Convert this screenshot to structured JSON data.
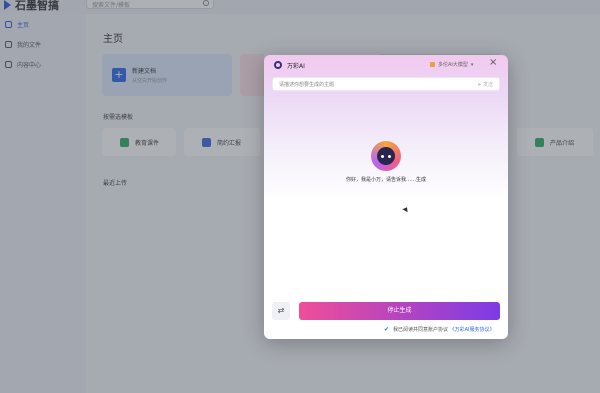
{
  "app": {
    "title": "石墨智搞",
    "search_placeholder": "搜索文件/模板"
  },
  "sidebar": {
    "items": [
      {
        "label": "主页",
        "active": true
      },
      {
        "label": "我的文件"
      },
      {
        "label": "内容中心"
      }
    ]
  },
  "main": {
    "title": "主页",
    "new_card": {
      "title": "新建文档",
      "subtitle": "从空白开始创作"
    },
    "section_title": "按需选模板",
    "templates": [
      {
        "label": "教育课件",
        "color": "#2fae68"
      },
      {
        "label": "简约汇报",
        "color": "#3a6de0"
      },
      {
        "label": "产品介绍",
        "color": "#2fae68"
      }
    ],
    "recent_title": "最近上传"
  },
  "modal": {
    "title": "万彩AI",
    "model_label": "多伦AI大模型",
    "close_icon": "×",
    "input_placeholder": "请描述你想要生成的主题",
    "send_label": "发送",
    "welcome": "你好，我是小万，请告诉我……生成",
    "swap_icon": "⇄",
    "generate_label": "停止生成",
    "agree_text": "我已阅读并同意账户协议 ",
    "agree_link": "《万彩AI服务协议》"
  }
}
